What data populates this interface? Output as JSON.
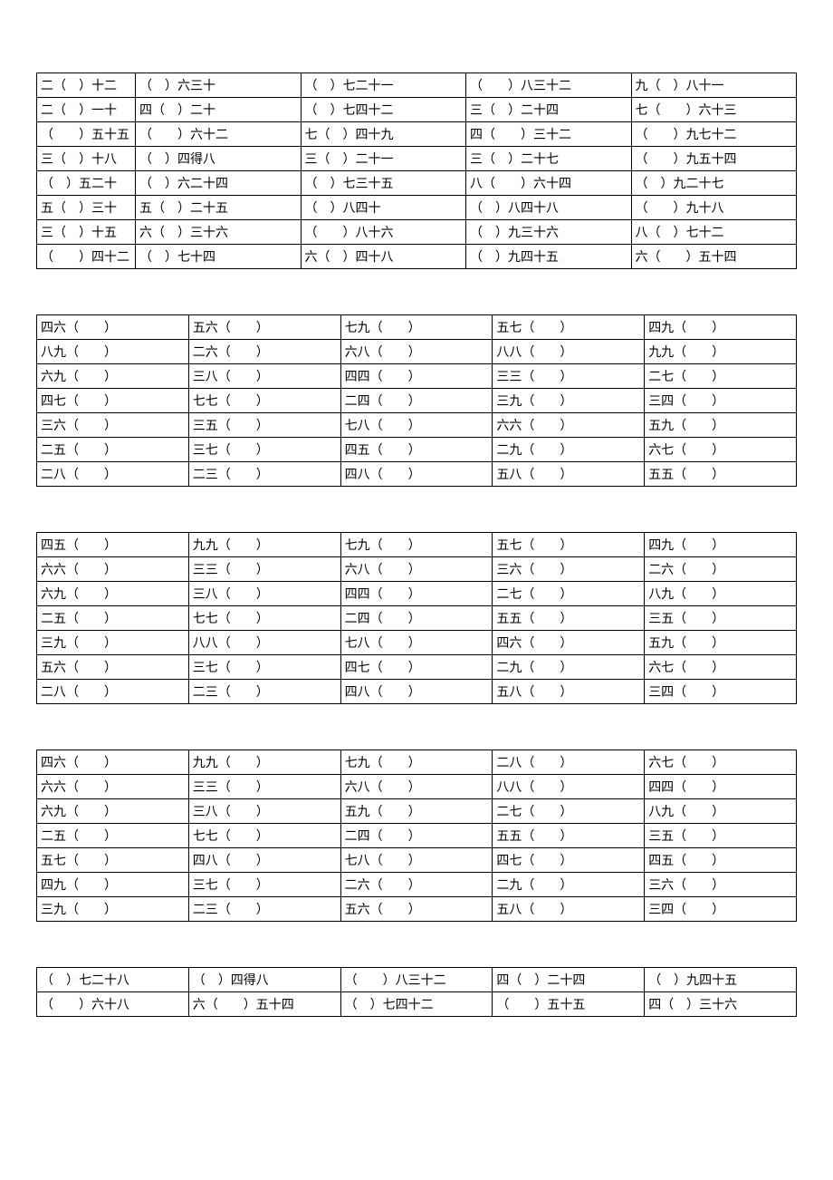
{
  "table1": [
    [
      "二（　）十二",
      "（　）六三十",
      "（　）七二十一",
      "（　　）八三十二",
      "九（　）八十一"
    ],
    [
      "二（　）一十",
      "四（　）二十",
      "（　）七四十二",
      "三（　）二十四",
      "七（　　）六十三"
    ],
    [
      "（　　）五十五",
      "（　　）六十二",
      "七（　）四十九",
      "四（　　）三十二",
      "（　　）九七十二"
    ],
    [
      "三（　）十八",
      "（　）四得八",
      "三（　）二十一",
      "三（　）二十七",
      "（　　）九五十四"
    ],
    [
      "（　）五二十",
      "（　）六二十四",
      "（　）七三十五",
      "八（　　）六十四",
      "（　）九二十七"
    ],
    [
      "五（　）三十",
      "五（　）二十五",
      "（　）八四十",
      "（　）八四十八",
      "（　　）九十八"
    ],
    [
      "三（　）十五",
      "六（　）三十六",
      "（　　）八十六",
      "（　）九三十六",
      "八（　）七十二"
    ],
    [
      "（　　）四十二",
      "（　）七十四",
      "六（　）四十八",
      "（　）九四十五",
      "六（　　）五十四"
    ]
  ],
  "table2": [
    [
      "四六（　　）",
      "五六（　　）",
      "七九（　　）",
      "五七（　　）",
      "四九（　　）"
    ],
    [
      "八九（　　）",
      "二六（　　）",
      "六八（　　）",
      "八八（　　）",
      "九九（　　）"
    ],
    [
      "六九（　　）",
      "三八（　　）",
      "四四（　　）",
      "三三（　　）",
      "二七（　　）"
    ],
    [
      "四七（　　）",
      "七七（　　）",
      "二四（　　）",
      "三九（　　）",
      "三四（　　）"
    ],
    [
      "三六（　　）",
      "三五（　　）",
      "七八（　　）",
      "六六（　　）",
      "五九（　　）"
    ],
    [
      "二五（　　）",
      "三七（　　）",
      "四五（　　）",
      "二九（　　）",
      "六七（　　）"
    ],
    [
      "二八（　　）",
      "二三（　　）",
      "四八（　　）",
      "五八（　　）",
      "五五（　　）"
    ]
  ],
  "table3": [
    [
      "四五（　　）",
      "九九（　　）",
      "七九（　　）",
      "五七（　　）",
      "四九（　　）"
    ],
    [
      "六六（　　）",
      "三三（　　）",
      "六八（　　）",
      "三六（　　）",
      "二六（　　）"
    ],
    [
      "六九（　　）",
      "三八（　　）",
      "四四（　　）",
      "二七（　　）",
      "八九（　　）"
    ],
    [
      "二五（　　）",
      "七七（　　）",
      "二四（　　）",
      "五五（　　）",
      "三五（　　）"
    ],
    [
      "三九（　　）",
      "八八（　　）",
      "七八（　　）",
      "四六（　　）",
      "五九（　　）"
    ],
    [
      "五六（　　）",
      "三七（　　）",
      "四七（　　）",
      "二九（　　）",
      "六七（　　）"
    ],
    [
      "二八（　　）",
      "二三（　　）",
      "四八（　　）",
      "五八（　　）",
      "三四（　　）"
    ]
  ],
  "table4": [
    [
      "四六（　　）",
      "九九（　　）",
      "七九（　　）",
      "二八（　　）",
      "六七（　　）"
    ],
    [
      "六六（　　）",
      "三三（　　）",
      "六八（　　）",
      "八八（　　）",
      "四四（　　）"
    ],
    [
      "六九（　　）",
      "三八（　　）",
      "五九（　　）",
      "二七（　　）",
      "八九（　　）"
    ],
    [
      "二五（　　）",
      "七七（　　）",
      "二四（　　）",
      "五五（　　）",
      "三五（　　）"
    ],
    [
      "五七（　　）",
      "四八（　　）",
      "七八（　　）",
      "四七（　　）",
      "四五（　　）"
    ],
    [
      "四九（　　）",
      "三七（　　）",
      "二六（　　）",
      "二九（　　）",
      "三六（　　）"
    ],
    [
      "三九（　　）",
      "二三（　　）",
      "五六（　　）",
      "五八（　　）",
      "三四（　　）"
    ]
  ],
  "table5": [
    [
      "（　）七二十八",
      "（　）四得八",
      "（　　）八三十二",
      "四（　）二十四",
      "（　）九四十五"
    ],
    [
      "（　　）六十八",
      "六（　　）五十四",
      "（　）七四十二",
      "（　　）五十五",
      "四（　）三十六"
    ]
  ]
}
